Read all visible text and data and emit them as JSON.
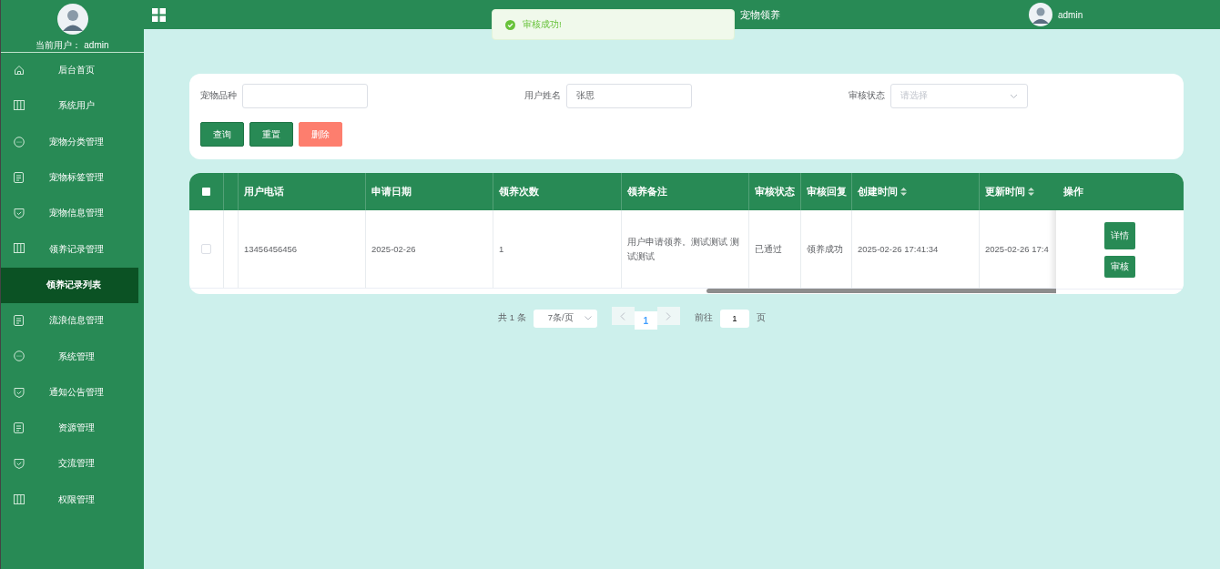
{
  "sidebar": {
    "current_user_label": "当前用户：",
    "current_user": "admin",
    "items": [
      {
        "label": "后台首页",
        "selected": false
      },
      {
        "label": "系统用户",
        "selected": false
      },
      {
        "label": "宠物分类管理",
        "selected": false
      },
      {
        "label": "宠物标签管理",
        "selected": false
      },
      {
        "label": "宠物信息管理",
        "selected": false
      },
      {
        "label": "领养记录管理",
        "selected": false
      },
      {
        "label": "领养记录列表",
        "selected": true
      },
      {
        "label": "流浪信息管理",
        "selected": false
      },
      {
        "label": "系统管理",
        "selected": false
      },
      {
        "label": "通知公告管理",
        "selected": false
      },
      {
        "label": "资源管理",
        "selected": false
      },
      {
        "label": "交流管理",
        "selected": false
      },
      {
        "label": "权限管理",
        "selected": false
      }
    ]
  },
  "header": {
    "title": "宠物领养",
    "user": "admin"
  },
  "toast": {
    "kind": "success",
    "message": "审核成功!"
  },
  "search": {
    "fields": [
      {
        "label": "宠物品种",
        "kind": "input"
      },
      {
        "label": "用户姓名",
        "kind": "input",
        "value": "张思"
      },
      {
        "label": "审核状态",
        "kind": "select",
        "placeholder": "请选择"
      }
    ],
    "buttons": [
      {
        "label": "查询",
        "kind": "primary"
      },
      {
        "label": "重置",
        "kind": "primary"
      },
      {
        "label": "删除",
        "kind": "danger"
      }
    ]
  },
  "table": {
    "columns": [
      {
        "label": "用户电话",
        "sortable": false
      },
      {
        "label": "申请日期",
        "sortable": false
      },
      {
        "label": "领养次数",
        "sortable": false
      },
      {
        "label": "领养备注",
        "sortable": false
      },
      {
        "label": "审核状态",
        "sortable": false
      },
      {
        "label": "审核回复",
        "sortable": false
      },
      {
        "label": "创建时间",
        "sortable": true
      },
      {
        "label": "更新时间",
        "sortable": true
      }
    ],
    "action_header": "操作",
    "select_all_checked": false,
    "rows": [
      {
        "checked": false,
        "cells": [
          "13456456456",
          "2025-02-26",
          "1",
          "用户申请领养。测试测试 测试测试",
          "已通过",
          "领养成功",
          "2025-02-26 17:41:34",
          "2025-02-26 17:4"
        ],
        "actions": [
          "详情",
          "审核"
        ]
      }
    ]
  },
  "pagination": {
    "total": "共 1 条",
    "page_size": "7条/页",
    "pages": [
      {
        "label": "1",
        "selected": true
      }
    ],
    "goto_label": "前往",
    "goto_value": "1",
    "page_unit": "页"
  }
}
